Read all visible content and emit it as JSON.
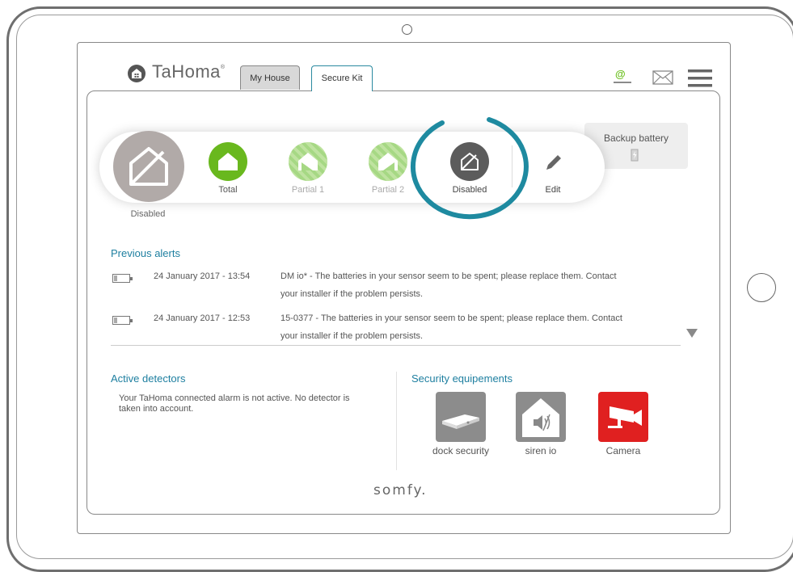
{
  "header": {
    "brand": "TaHoma",
    "brand_mark": "®",
    "tabs": [
      {
        "label": "My House"
      },
      {
        "label": "Secure Kit"
      }
    ],
    "icons": [
      "at-icon",
      "mail-icon",
      "menu-icon"
    ]
  },
  "modes": {
    "current": {
      "label": "Disabled"
    },
    "items": [
      {
        "label": "Total"
      },
      {
        "label": "Partial 1"
      },
      {
        "label": "Partial 2"
      },
      {
        "label": "Disabled"
      },
      {
        "label": "Edit"
      }
    ]
  },
  "backup": {
    "label": "Backup battery"
  },
  "alerts": {
    "title": "Previous alerts",
    "items": [
      {
        "date": "24 January 2017 - 13:54",
        "line1": "DM io* - The batteries in your sensor seem to be spent; please replace them. Contact",
        "line2": "your installer if the problem persists."
      },
      {
        "date": "24 January 2017 - 12:53",
        "line1": "15-0377 - The batteries in your sensor seem to be spent; please replace them. Contact",
        "line2": "your installer if the problem persists."
      }
    ]
  },
  "detectors": {
    "title": "Active detectors",
    "text": "Your TaHoma connected alarm is not active. No detector is taken into account."
  },
  "equipments": {
    "title": "Security equipements",
    "items": [
      {
        "label": "dock security"
      },
      {
        "label": "siren io"
      },
      {
        "label": "Camera"
      }
    ]
  },
  "footer": {
    "brand": "somfy."
  },
  "colors": {
    "accent": "#1e8aa0",
    "green": "#69b81e",
    "camera_red": "#e02020",
    "grey_tile": "#8c8c8c"
  }
}
